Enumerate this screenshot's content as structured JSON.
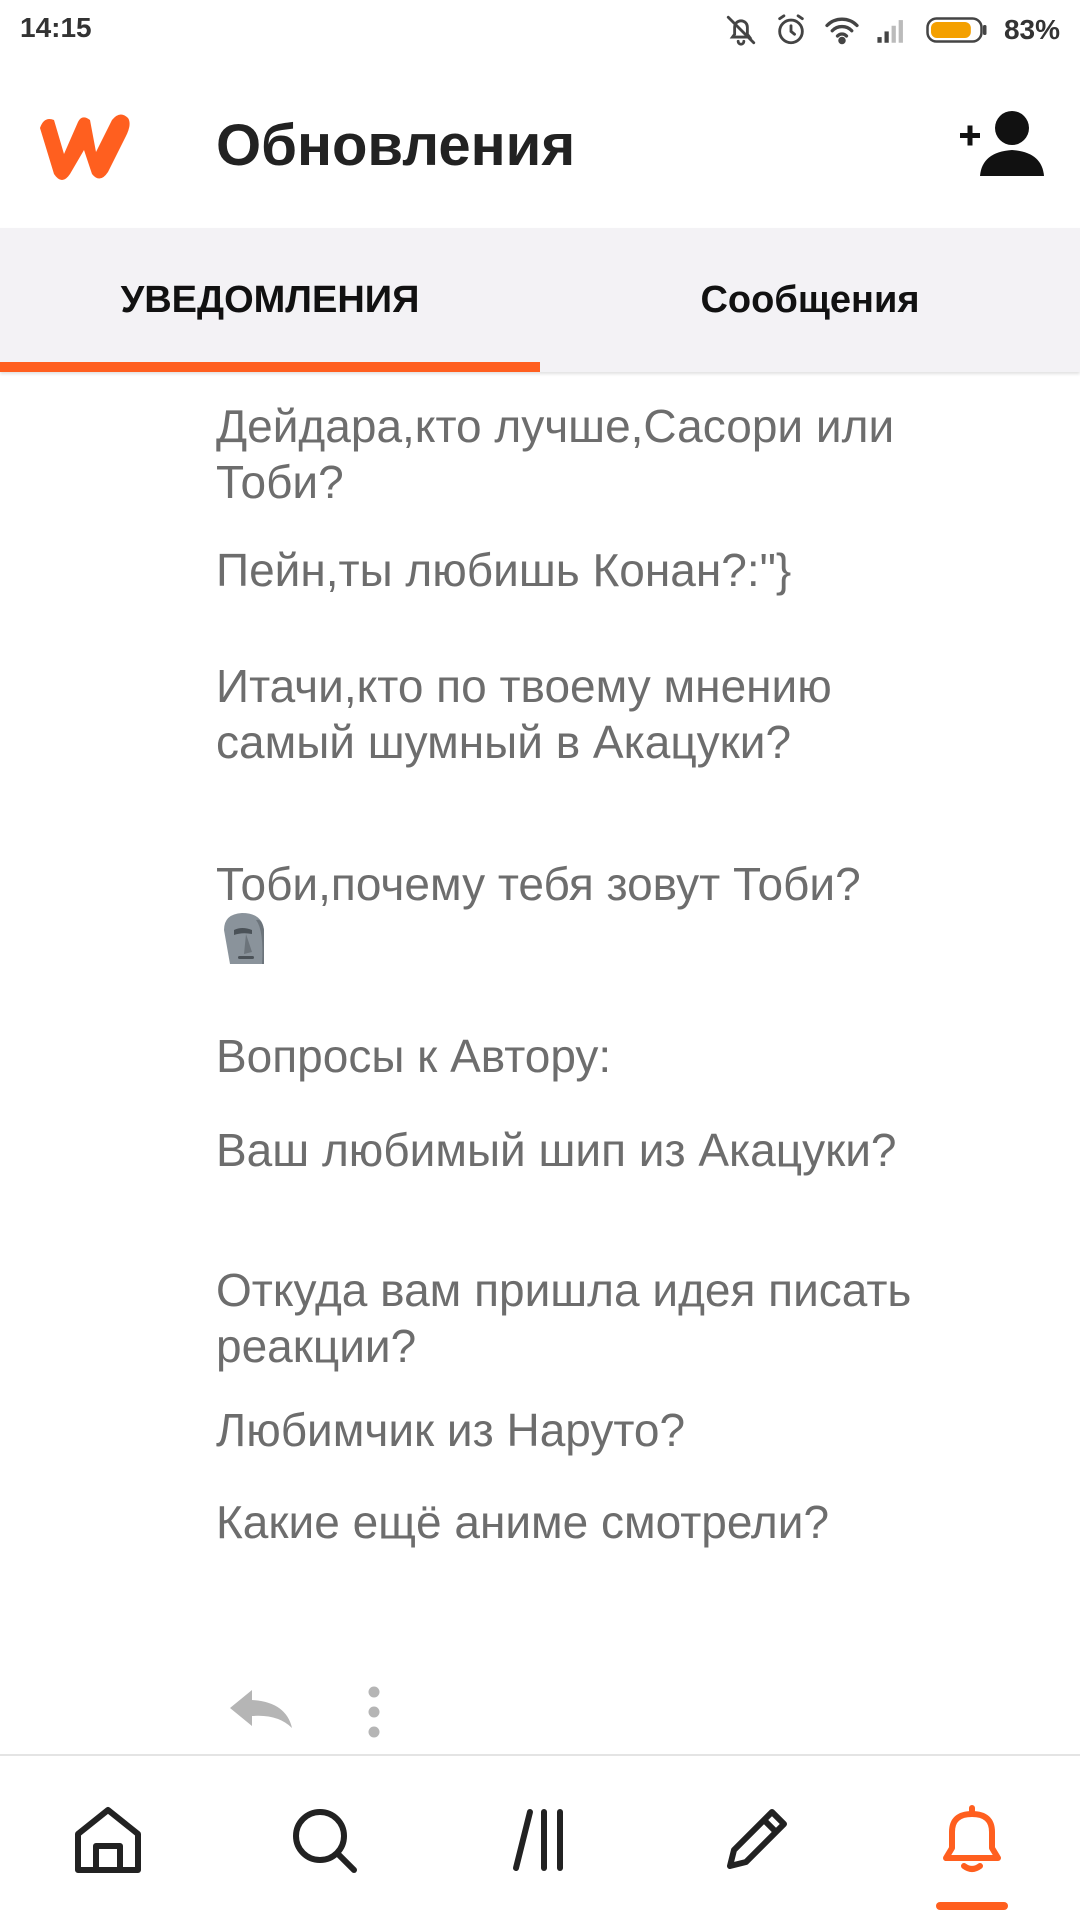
{
  "status_bar": {
    "time": "14:15",
    "battery_percent": "83%",
    "battery_level": 0.83,
    "icons": [
      "bell-off-icon",
      "alarm-icon",
      "wifi-icon",
      "signal-icon",
      "battery-icon"
    ]
  },
  "header": {
    "logo": "wattpad-logo",
    "title": "Обновления",
    "add_friend_icon": "add-person-icon"
  },
  "tabs": [
    {
      "label": "УВЕДОМЛЕНИЯ",
      "active": true
    },
    {
      "label": "Сообщения",
      "active": false
    }
  ],
  "colors": {
    "accent": "#ff5f1f",
    "text_muted": "#6d6d6d",
    "tab_bg": "#f3f2f5"
  },
  "comment": {
    "lines": [
      "Дейдара,кто лучше,Сасори или Тоби?",
      "Пейн,ты любишь Конан?:\"}",
      "Итачи,кто по твоему мнению самый шумный в Акацуки?",
      "Тоби,почему тебя зовут Тоби?",
      "Вопросы к Автору:",
      "Ваш любимый шип из Акацуки?",
      "Откуда вам пришла идея писать реакции?",
      "Любимчик из Наруто?",
      "Какие ещё аниме смотрели?"
    ],
    "emoji": "moai-icon",
    "actions": [
      "reply-icon",
      "more-vertical-icon"
    ]
  },
  "bottom_nav": [
    {
      "icon": "home-icon",
      "active": false
    },
    {
      "icon": "search-icon",
      "active": false
    },
    {
      "icon": "library-icon",
      "active": false
    },
    {
      "icon": "pencil-icon",
      "active": false
    },
    {
      "icon": "bell-icon",
      "active": true
    }
  ]
}
